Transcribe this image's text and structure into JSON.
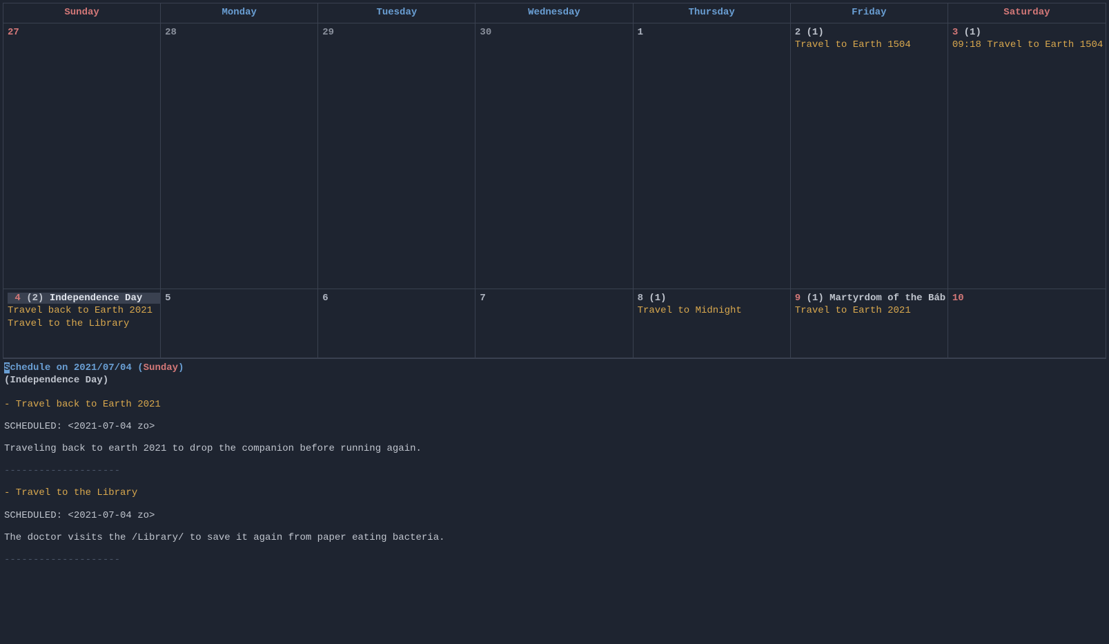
{
  "header": {
    "days": [
      "Sunday",
      "Monday",
      "Tuesday",
      "Wednesday",
      "Thursday",
      "Friday",
      "Saturday"
    ]
  },
  "week1": {
    "sun": {
      "num": "27"
    },
    "mon": {
      "num": "28"
    },
    "tue": {
      "num": "29"
    },
    "wed": {
      "num": "30"
    },
    "thu": {
      "num": "1"
    },
    "fri": {
      "num": "2",
      "count": "(1)",
      "events": [
        "Travel to Earth 1504"
      ]
    },
    "sat": {
      "num": "3",
      "count": "(1)",
      "events": [
        "09:18 Travel to Earth 1504"
      ]
    }
  },
  "week2": {
    "sun": {
      "num": "4",
      "count": "(2)",
      "holiday": "Independence Day",
      "events": [
        "Travel back to Earth 2021",
        "Travel to the Library"
      ]
    },
    "mon": {
      "num": "5"
    },
    "tue": {
      "num": "6"
    },
    "wed": {
      "num": "7"
    },
    "thu": {
      "num": "8",
      "count": "(1)",
      "events": [
        "Travel to Midnight"
      ]
    },
    "fri": {
      "num": "9",
      "count": "(1)",
      "holiday": "Martyrdom of the Báb",
      "events": [
        "Travel to Earth 2021"
      ]
    },
    "sat": {
      "num": "10"
    }
  },
  "schedule": {
    "prefix": "Schedule on ",
    "prefix_first": "S",
    "prefix_rest": "chedule on ",
    "date": "2021/07/04",
    "lparen": " (",
    "dayname": "Sunday",
    "rparen": ")",
    "holiday": "(Independence Day)",
    "items": [
      {
        "title": "- Travel back to Earth 2021",
        "sched": "   SCHEDULED: <2021-07-04 zo>",
        "body": "   Traveling back to earth 2021 to drop the companion before running again."
      },
      {
        "title": "- Travel to the Library",
        "sched": "   SCHEDULED: <2021-07-04 zo>",
        "body": "   The doctor visits the /Library/ to save it again from paper eating bacteria."
      }
    ],
    "divider": "--------------------"
  }
}
